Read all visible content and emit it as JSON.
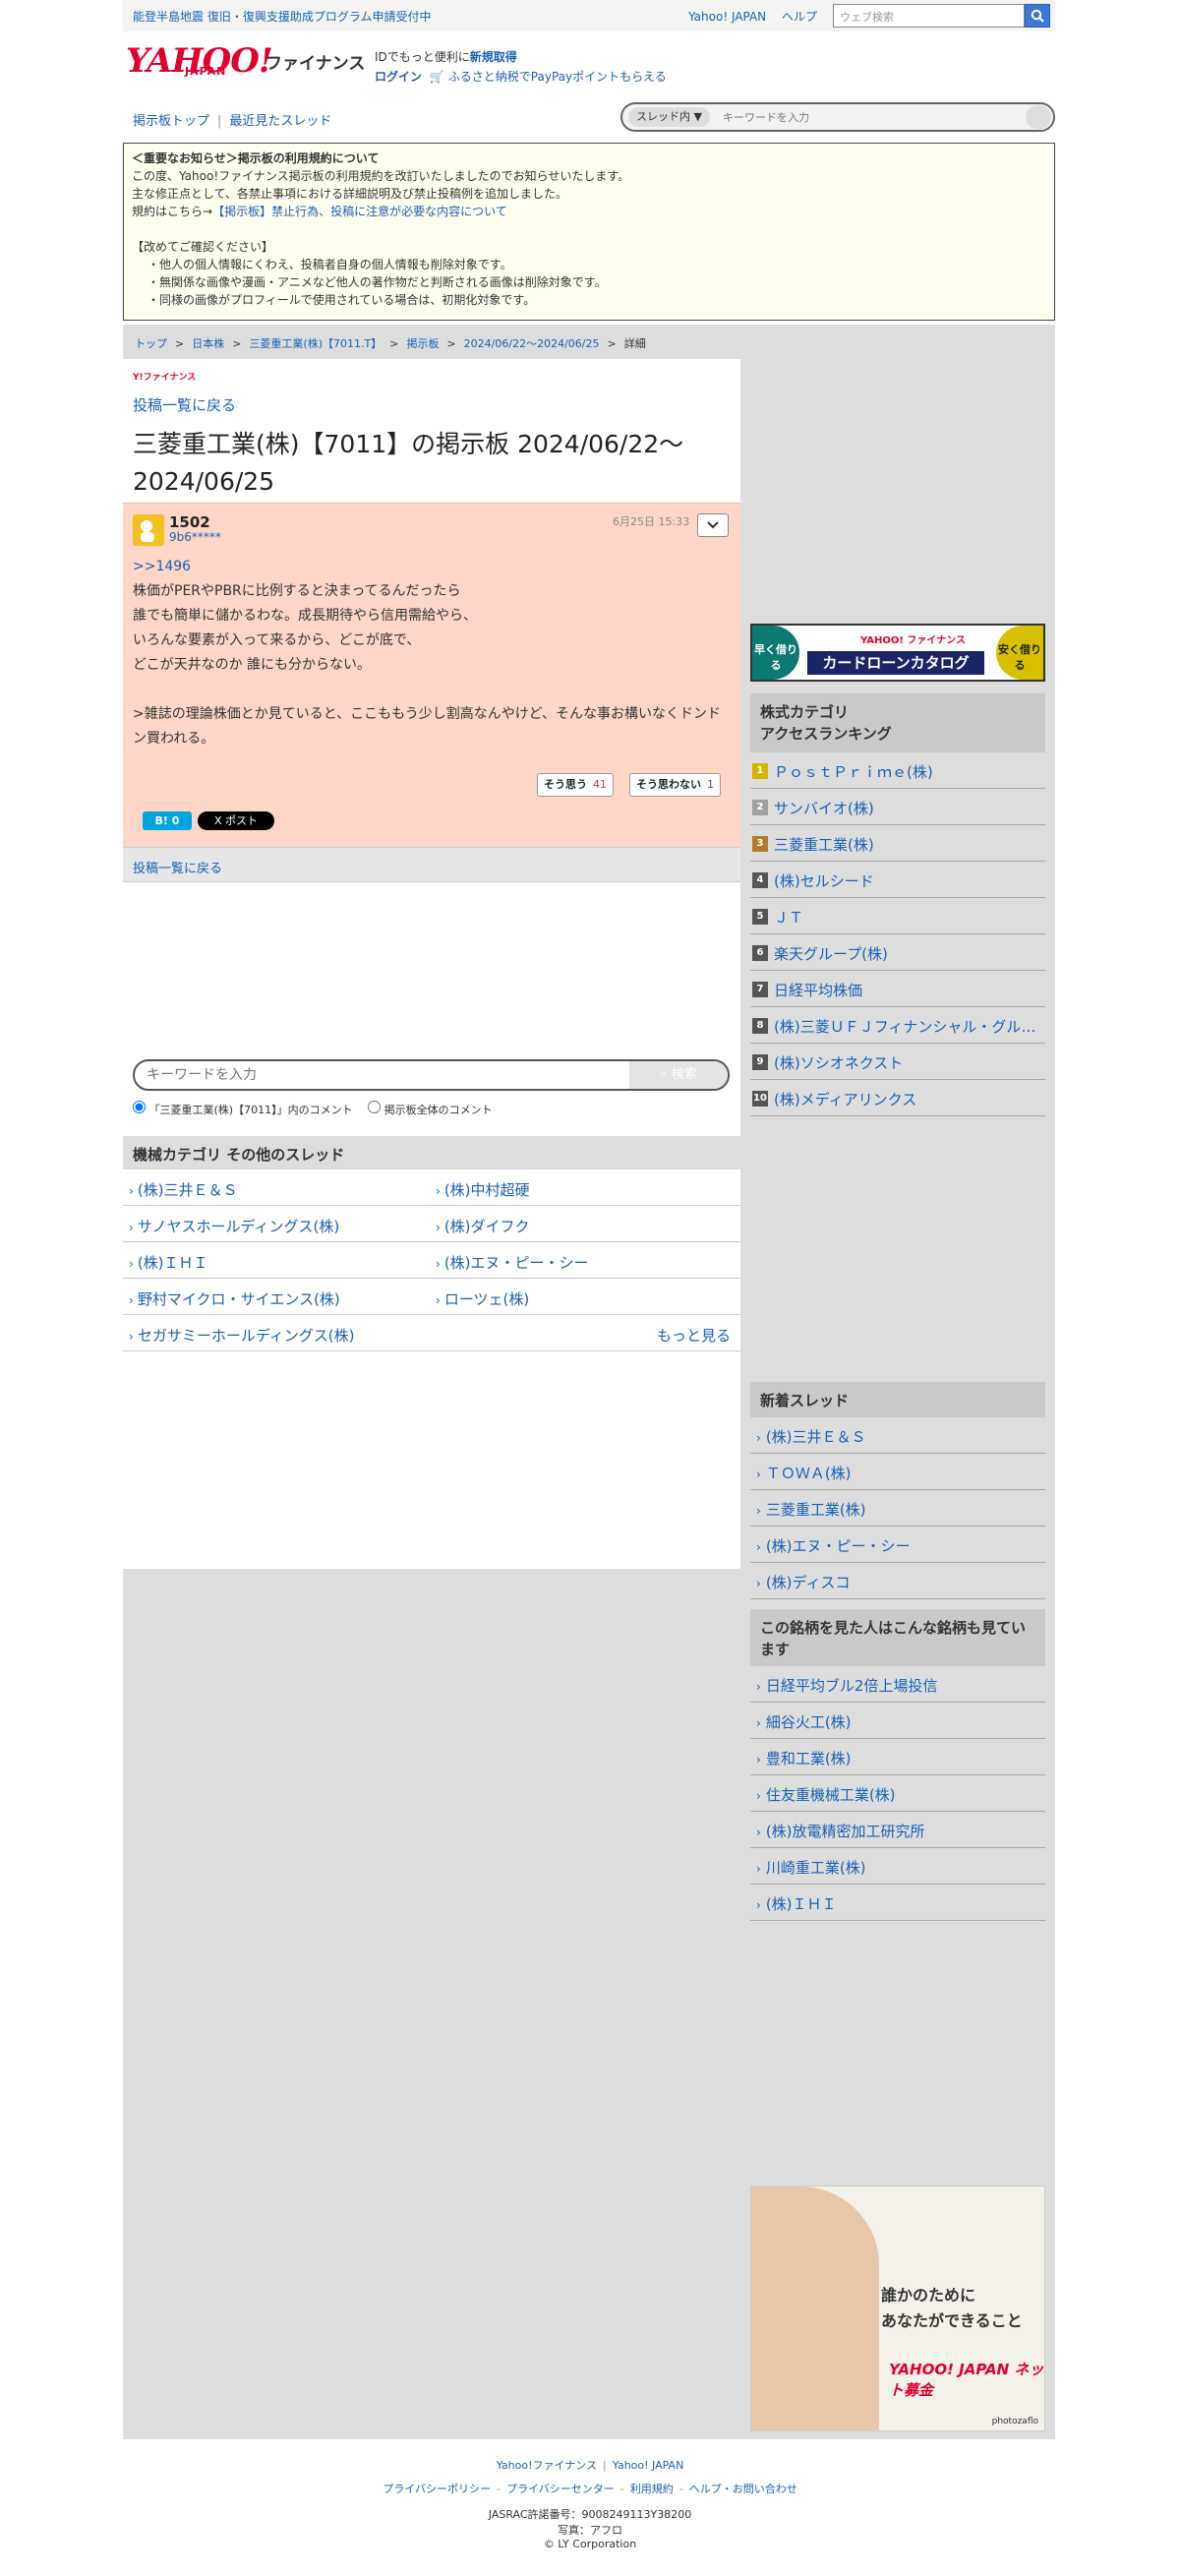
{
  "topbar": {
    "notice": "能登半島地震 復旧・復興支援助成プログラム申請受付中",
    "link_yahoo": "Yahoo! JAPAN",
    "link_help": "ヘルプ",
    "search_placeholder": "ウェブ検索"
  },
  "header": {
    "logo": "YAHOO!",
    "logo_sub": "JAPAN",
    "logo_section": "ファイナンス",
    "promo_line1": "IDでもっと便利に",
    "promo_signup": "新規取得",
    "promo_login": "ログイン",
    "promo_furusato": "ふるさと納税でPayPayポイントもらえる"
  },
  "board_nav": {
    "top": "掲示板トップ",
    "recent": "最近見たスレッド",
    "scope": "スレッド内",
    "search_placeholder": "キーワードを入力"
  },
  "notice": {
    "title": "＜重要なお知らせ＞掲示板の利用規約について",
    "line1": "この度、Yahoo!ファイナンス掲示板の利用規約を改訂いたしましたのでお知らせいたします。",
    "line2": "主な修正点として、各禁止事項における詳細説明及び禁止投稿例を追加しました。",
    "line3_prefix": "規約はこちら→",
    "line3_link": "【掲示板】禁止行為、投稿に注意が必要な内容について",
    "check_title": "【改めてご確認ください】",
    "check1": "・他人の個人情報にくわえ、投稿者自身の個人情報も削除対象です。",
    "check2": "・無関係な画像や漫画・アニメなど他人の著作物だと判断される画像は削除対象です。",
    "check3": "・同様の画像がプロフィールで使用されている場合は、初期化対象です。"
  },
  "breadcrumb": [
    "トップ",
    "日本株",
    "三菱重工業(株)【7011.T】",
    "掲示板",
    "2024/06/22〜2024/06/25",
    "詳細"
  ],
  "left": {
    "logo_small": "Y!ファイナンス",
    "back_link": "投稿一覧に戻る",
    "title": "三菱重工業(株)【7011】の掲示板 2024/06/22〜2024/06/25"
  },
  "post": {
    "number": "1502",
    "user": "9b6*****",
    "date": "6月25日 15:33",
    "reply_to": ">>1496",
    "body": "株価がPERやPBRに比例すると決まってるんだったら\n誰でも簡単に儲かるわな。成長期待やら信用需給やら、\nいろんな要素が入って来るから、どこが底で、\nどこが天井なのか 誰にも分からない。\n\n>雑誌の理論株価とか見ていると、ここももう少し割高なんやけど、そんな事お構いなくドンドン買われる。",
    "agree_label": "そう思う",
    "agree_count": "41",
    "disagree_label": "そう思わない",
    "disagree_count": "1",
    "hatena": "B! 0",
    "xpost": "X ポスト"
  },
  "bottom": {
    "back_link": "投稿一覧に戻る",
    "kw_placeholder": "キーワードを入力",
    "kw_button": "検索",
    "radio1": "「三菱重工業(株)【7011】」内のコメント",
    "radio2": "掲示板全体のコメント"
  },
  "other_threads": {
    "heading": "機械カテゴリ その他のスレッド",
    "items": [
      "(株)三井Ｅ＆Ｓ",
      "(株)中村超硬",
      "サノヤスホールディングス(株)",
      "(株)ダイフク",
      "(株)ＩＨＩ",
      "(株)エヌ・ピー・シー",
      "野村マイクロ・サイエンス(株)",
      "ローツェ(株)",
      "セガサミーホールディングス(株)"
    ],
    "more": "もっと見る"
  },
  "banner": {
    "left": "早く借りる",
    "right": "安く借りる",
    "brand": "YAHOO! ファイナンス",
    "title": "カードローンカタログ"
  },
  "ranking": {
    "heading": "株式カテゴリ\nアクセスランキング",
    "items": [
      "ＰｏｓｔＰｒｉｍｅ(株)",
      "サンバイオ(株)",
      "三菱重工業(株)",
      "(株)セルシード",
      "ＪＴ",
      "楽天グループ(株)",
      "日経平均株価",
      "(株)三菱ＵＦＪフィナンシャル・グループ",
      "(株)ソシオネクスト",
      "(株)メディアリンクス"
    ]
  },
  "new_threads": {
    "heading": "新着スレッド",
    "items": [
      "(株)三井Ｅ＆Ｓ",
      "ＴＯＷＡ(株)",
      "三菱重工業(株)",
      "(株)エヌ・ピー・シー",
      "(株)ディスコ"
    ]
  },
  "also_viewed": {
    "heading": "この銘柄を見た人はこんな銘柄も見ています",
    "items": [
      "日経平均ブル2倍上場投信",
      "細谷火工(株)",
      "豊和工業(株)",
      "住友重機械工業(株)",
      "(株)放電精密加工研究所",
      "川崎重工業(株)",
      "(株)ＩＨＩ"
    ]
  },
  "ad": {
    "line1": "誰かのために",
    "line2": "あなたができること",
    "brand": "YAHOO! JAPAN ネット募金",
    "credit": "photozaflo"
  },
  "footer": {
    "link1": "Yahoo!ファイナンス",
    "link2": "Yahoo! JAPAN",
    "link3": "プライバシーポリシー",
    "link4": "プライバシーセンター",
    "link5": "利用規約",
    "link6": "ヘルプ・お問い合わせ",
    "jasrac": "JASRAC許諾番号：9008249113Y38200",
    "photo": "写真：アフロ",
    "copyright": "© LY Corporation"
  },
  "colors": {
    "brand_red": "#e1002d",
    "link_blue": "#1a5fb4",
    "post_bg": "#fdd6c7",
    "notice_bg": "#fffff0"
  }
}
